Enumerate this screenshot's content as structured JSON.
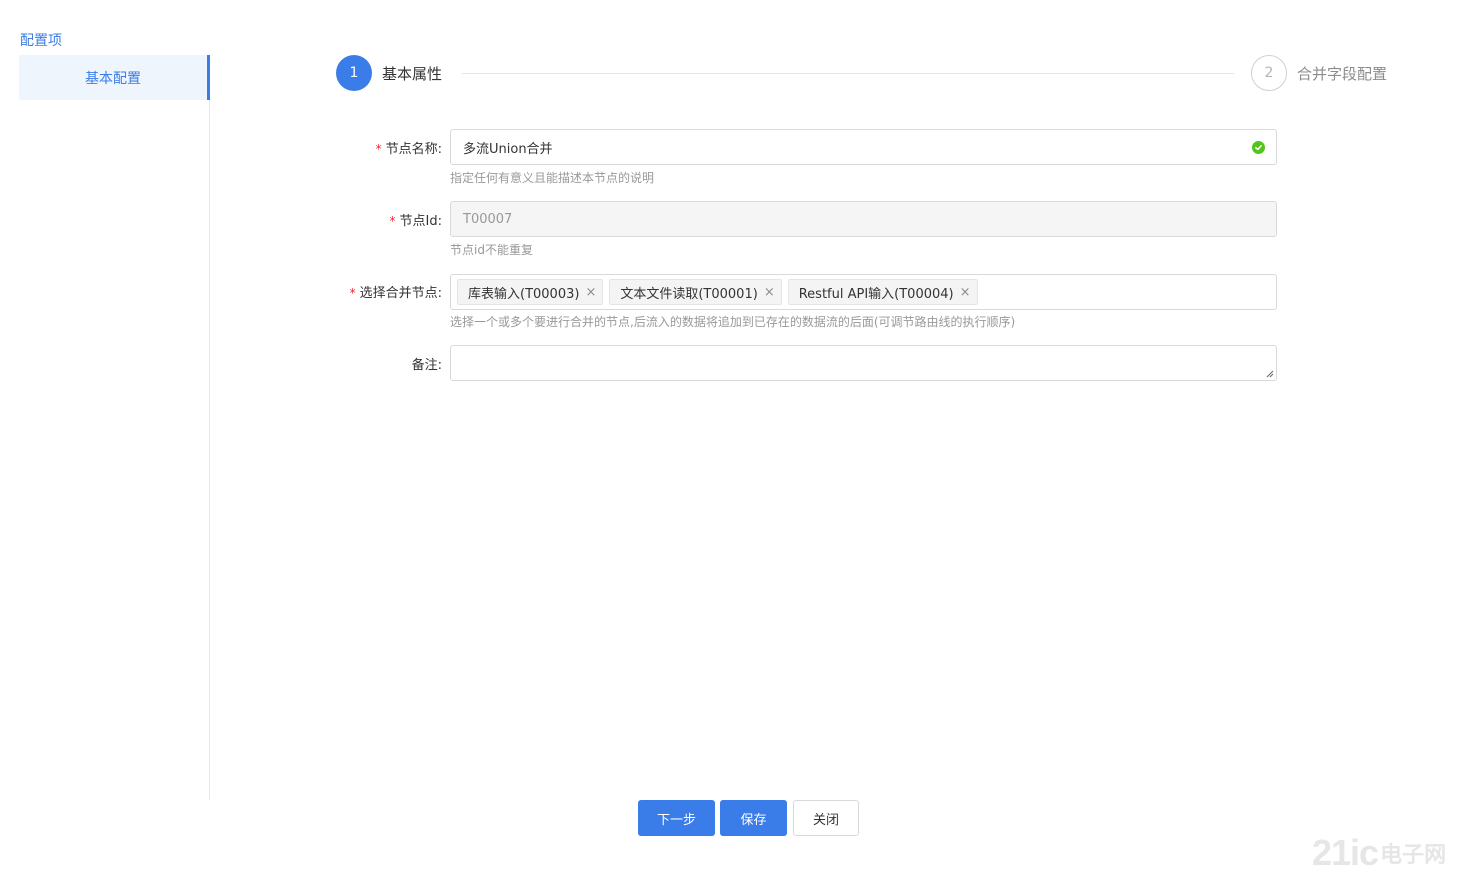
{
  "sidebar": {
    "title": "配置项",
    "items": [
      {
        "label": "基本配置",
        "active": true
      }
    ]
  },
  "steps": [
    {
      "number": "1",
      "label": "基本属性",
      "state": "active"
    },
    {
      "number": "2",
      "label": "合并字段配置",
      "state": "pending"
    }
  ],
  "form": {
    "node_name": {
      "label": "节点名称:",
      "required_mark": "*",
      "value": "多流Union合并",
      "help": "指定任何有意义且能描述本节点的说明",
      "valid": true
    },
    "node_id": {
      "label": "节点Id:",
      "required_mark": "*",
      "value": "T00007",
      "help": "节点id不能重复",
      "disabled": true
    },
    "merge_nodes": {
      "label": "选择合并节点:",
      "required_mark": "*",
      "tags": [
        "库表输入(T00003)",
        "文本文件读取(T00001)",
        "Restful API输入(T00004)"
      ],
      "remove_glyph": "×",
      "help": "选择一个或多个要进行合并的节点,后流入的数据将追加到已存在的数据流的后面(可调节路由线的执行顺序)"
    },
    "remark": {
      "label": "备注:",
      "value": ""
    }
  },
  "buttons": {
    "next": "下一步",
    "save": "保存",
    "close": "关闭"
  },
  "watermark": {
    "part1": "21ic",
    "part2": "电子网"
  },
  "colors": {
    "primary": "#3a7ce8",
    "success": "#52c41a",
    "required": "#f5222d"
  }
}
